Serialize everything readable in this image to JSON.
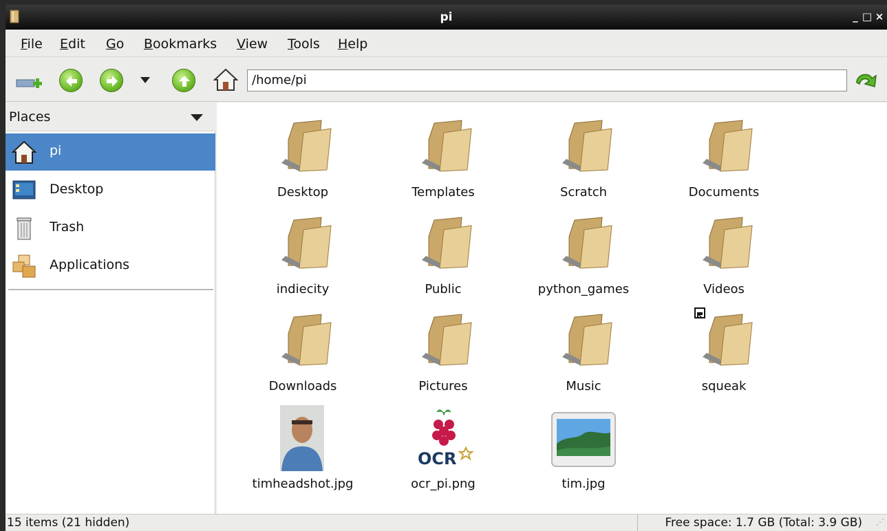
{
  "window": {
    "title": "pi",
    "minimize": "_",
    "maximize": "□",
    "close": "×"
  },
  "menubar": {
    "items": [
      {
        "accel": "F",
        "rest": "ile"
      },
      {
        "accel": "E",
        "rest": "dit"
      },
      {
        "accel": "G",
        "rest": "o"
      },
      {
        "accel": "B",
        "rest": "ookmarks"
      },
      {
        "accel": "V",
        "rest": "iew"
      },
      {
        "accel": "T",
        "rest": "ools"
      },
      {
        "accel": "H",
        "rest": "elp"
      }
    ]
  },
  "toolbar": {
    "path": "/home/pi",
    "icons": [
      "new-tab-icon",
      "back-icon",
      "forward-icon",
      "history-dropdown-icon",
      "up-icon",
      "home-icon",
      "go-icon"
    ]
  },
  "sidebar": {
    "header": "Places",
    "items": [
      {
        "label": "pi",
        "icon": "home-icon",
        "selected": true
      },
      {
        "label": "Desktop",
        "icon": "desktop-icon"
      },
      {
        "label": "Trash",
        "icon": "trash-icon"
      },
      {
        "label": "Applications",
        "icon": "applications-icon"
      }
    ]
  },
  "files": [
    {
      "name": "Desktop",
      "type": "folder"
    },
    {
      "name": "Templates",
      "type": "folder"
    },
    {
      "name": "Scratch",
      "type": "folder"
    },
    {
      "name": "Documents",
      "type": "folder"
    },
    {
      "name": "indiecity",
      "type": "folder"
    },
    {
      "name": "Public",
      "type": "folder"
    },
    {
      "name": "python_games",
      "type": "folder"
    },
    {
      "name": "Videos",
      "type": "folder"
    },
    {
      "name": "Downloads",
      "type": "folder"
    },
    {
      "name": "Pictures",
      "type": "folder"
    },
    {
      "name": "Music",
      "type": "folder"
    },
    {
      "name": "squeak",
      "type": "folder-symlink"
    },
    {
      "name": "timheadshot.jpg",
      "type": "photo"
    },
    {
      "name": "ocr_pi.png",
      "type": "image",
      "logo_text": "OCR"
    },
    {
      "name": "tim.jpg",
      "type": "image-generic"
    }
  ],
  "status": {
    "items": "15 items (21 hidden)",
    "free_space": "Free space: 1.7 GB (Total: 3.9 GB)"
  },
  "colors": {
    "selection": "#4a86c8",
    "folder": "#d8b97e",
    "titlebar": "#0c0c0c",
    "nav_button": "#6fbb2c"
  }
}
